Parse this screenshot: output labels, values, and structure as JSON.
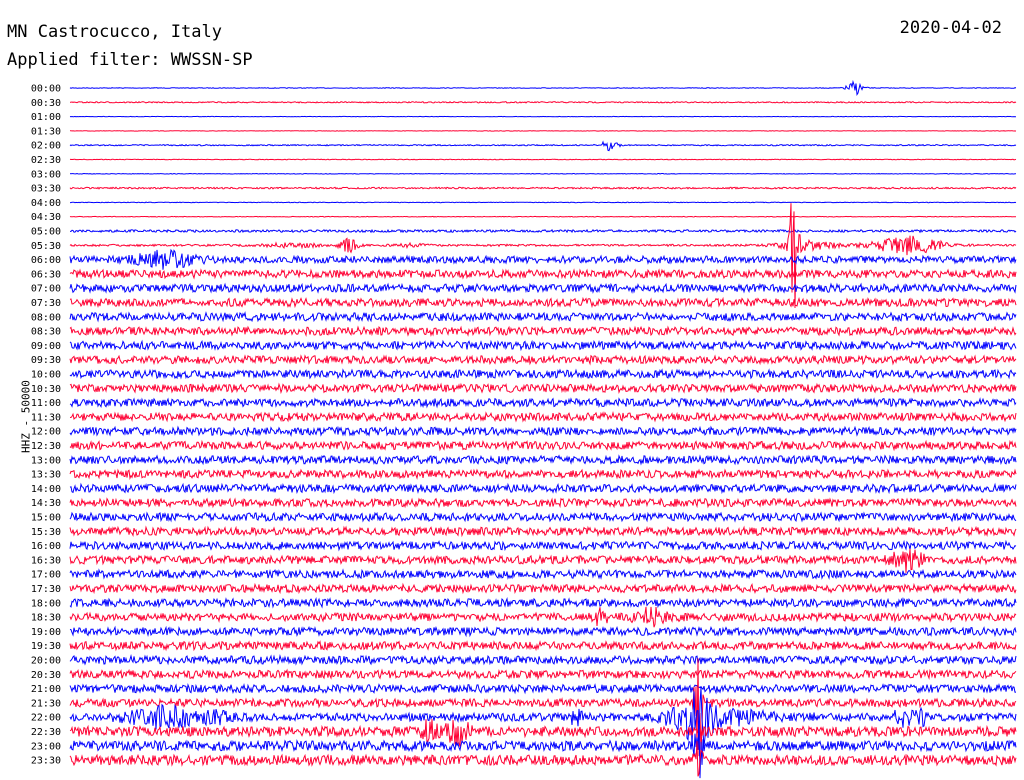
{
  "header": {
    "station": "MN Castrocucco, Italy",
    "filter": "Applied filter: WWSSN-SP",
    "date": "2020-04-02"
  },
  "chart_data": {
    "type": "line",
    "title": "MN Castrocucco, Italy",
    "subtitle": "Applied filter: WWSSN-SP",
    "date": "2020-04-02",
    "ylabel": "HHZ - 50000",
    "row_labels": [
      "00:00",
      "00:30",
      "01:00",
      "01:30",
      "02:00",
      "02:30",
      "03:00",
      "03:30",
      "04:00",
      "04:30",
      "05:00",
      "05:30",
      "06:00",
      "06:30",
      "07:00",
      "07:30",
      "08:00",
      "08:30",
      "09:00",
      "09:30",
      "10:00",
      "10:30",
      "11:00",
      "11:30",
      "12:00",
      "12:30",
      "13:00",
      "13:30",
      "14:00",
      "14:30",
      "15:00",
      "15:30",
      "16:00",
      "16:30",
      "17:00",
      "17:30",
      "18:00",
      "18:30",
      "19:00",
      "19:30",
      "20:00",
      "20:30",
      "21:00",
      "21:30",
      "22:00",
      "22:30",
      "23:00",
      "23:30"
    ],
    "series_colors": [
      "#0000ff",
      "#ff0033"
    ],
    "noise_level": [
      0.3,
      0.6,
      0.2,
      0.25,
      0.6,
      0.3,
      0.3,
      0.8,
      0.3,
      0.3,
      1.2,
      1.0,
      3.5,
      4,
      4,
      4,
      4,
      4,
      4,
      4,
      4,
      4,
      4,
      4,
      4,
      4,
      4,
      4,
      4,
      4,
      4,
      4,
      4,
      4,
      4,
      4,
      4,
      4,
      4,
      4,
      4,
      4,
      4,
      4,
      4,
      5,
      5,
      5
    ],
    "events": [
      {
        "row": 0,
        "x": 0.83,
        "amp": 7,
        "width": 0.006
      },
      {
        "row": 4,
        "x": 0.57,
        "amp": 5,
        "width": 0.006
      },
      {
        "row": 11,
        "x": 0.295,
        "amp": 8,
        "width": 0.006
      },
      {
        "row": 11,
        "x": 0.235,
        "amp": 2,
        "width": 0.02
      },
      {
        "row": 11,
        "x": 0.36,
        "amp": 2,
        "width": 0.01
      },
      {
        "row": 11,
        "x": 0.765,
        "amp": 65,
        "width": 0.003
      },
      {
        "row": 11,
        "x": 0.78,
        "amp": 5,
        "width": 0.02
      },
      {
        "row": 11,
        "x": 0.885,
        "amp": 9,
        "width": 0.025
      },
      {
        "row": 12,
        "x": 0.1,
        "amp": 7,
        "width": 0.02
      },
      {
        "row": 33,
        "x": 0.885,
        "amp": 9,
        "width": 0.012
      },
      {
        "row": 37,
        "x": 0.56,
        "amp": 7,
        "width": 0.006
      },
      {
        "row": 37,
        "x": 0.615,
        "amp": 7,
        "width": 0.012
      },
      {
        "row": 43,
        "x": 0.665,
        "amp": 70,
        "width": 0.003
      },
      {
        "row": 44,
        "x": 0.1,
        "amp": 9,
        "width": 0.025
      },
      {
        "row": 44,
        "x": 0.155,
        "amp": 5,
        "width": 0.01
      },
      {
        "row": 44,
        "x": 0.535,
        "amp": 7,
        "width": 0.004
      },
      {
        "row": 44,
        "x": 0.635,
        "amp": 7,
        "width": 0.008
      },
      {
        "row": 44,
        "x": 0.665,
        "amp": 30,
        "width": 0.012
      },
      {
        "row": 44,
        "x": 0.71,
        "amp": 7,
        "width": 0.02
      },
      {
        "row": 44,
        "x": 0.79,
        "amp": 5,
        "width": 0.004
      },
      {
        "row": 44,
        "x": 0.88,
        "amp": 7,
        "width": 0.008
      },
      {
        "row": 44,
        "x": 0.9,
        "amp": 6,
        "width": 0.004
      },
      {
        "row": 45,
        "x": 0.38,
        "amp": 9,
        "width": 0.006
      },
      {
        "row": 45,
        "x": 0.41,
        "amp": 11,
        "width": 0.008
      },
      {
        "row": 46,
        "x": 0.665,
        "amp": 30,
        "width": 0.003
      },
      {
        "row": 47,
        "x": 0.665,
        "amp": 20,
        "width": 0.003
      }
    ]
  }
}
